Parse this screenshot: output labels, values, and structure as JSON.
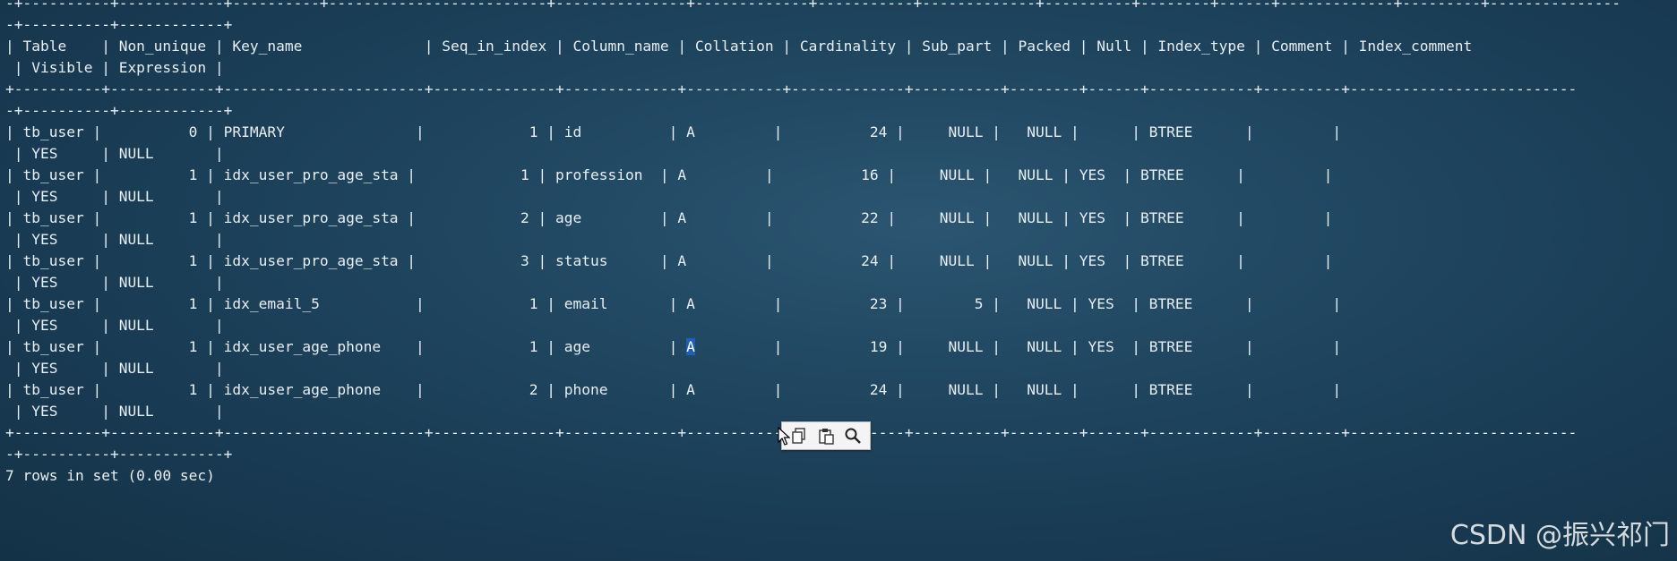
{
  "terminal": {
    "lines": [
      "-+----------+------------+----------+-------------------------+---------------+-------------+-----------+-------------+----------+--------+------+-------------+---------+---------------",
      "-+----------+------------+",
      "| Table    | Non_unique | Key_name              | Seq_in_index | Column_name | Collation | Cardinality | Sub_part | Packed | Null | Index_type | Comment | Index_comment",
      " | Visible | Expression |",
      "+----------+------------+-----------------------+--------------+-------------+-----------+-------------+----------+--------+------+------------+---------+--------------------------",
      "-+----------+------------+",
      "| tb_user |          0 | PRIMARY               |            1 | id          | A         |          24 |     NULL |   NULL |      | BTREE      |         |",
      " | YES     | NULL       |",
      "| tb_user |          1 | idx_user_pro_age_sta |            1 | profession  | A         |          16 |     NULL |   NULL | YES  | BTREE      |         |",
      " | YES     | NULL       |",
      "| tb_user |          1 | idx_user_pro_age_sta |            2 | age         | A         |          22 |     NULL |   NULL | YES  | BTREE      |         |",
      " | YES     | NULL       |",
      "| tb_user |          1 | idx_user_pro_age_sta |            3 | status      | A         |          24 |     NULL |   NULL | YES  | BTREE      |         |",
      " | YES     | NULL       |",
      "| tb_user |          1 | idx_email_5           |            1 | email       | A         |          23 |        5 |   NULL | YES  | BTREE      |         |",
      " | YES     | NULL       |",
      "| tb_user |          1 | idx_user_age_phone    |            1 | age         | ",
      " | YES     | NULL       |",
      "| tb_user |          1 | idx_user_age_phone    |            2 | phone       | A         |          24 |     NULL |   NULL |      | BTREE      |         |",
      " | YES     | NULL       |",
      "+----------+------------+-----------------------+--------------+-------------+-----------+-------------+----------+--------+------+------------+---------+--------------------------",
      "-+----------+------------+",
      "7 rows in set (0.00 sec)"
    ],
    "selected_row": {
      "prefix": "| tb_user |          1 | idx_user_age_phone    |            1 | age         | ",
      "selected_text": "A",
      "suffix": "         |          19 |     NULL |   NULL | YES  | BTREE      |         |"
    }
  },
  "popup": {
    "buttons": [
      {
        "icon": "copy-icon"
      },
      {
        "icon": "paste-icon"
      },
      {
        "icon": "search-icon"
      }
    ]
  },
  "watermark": "CSDN @振兴祁门"
}
